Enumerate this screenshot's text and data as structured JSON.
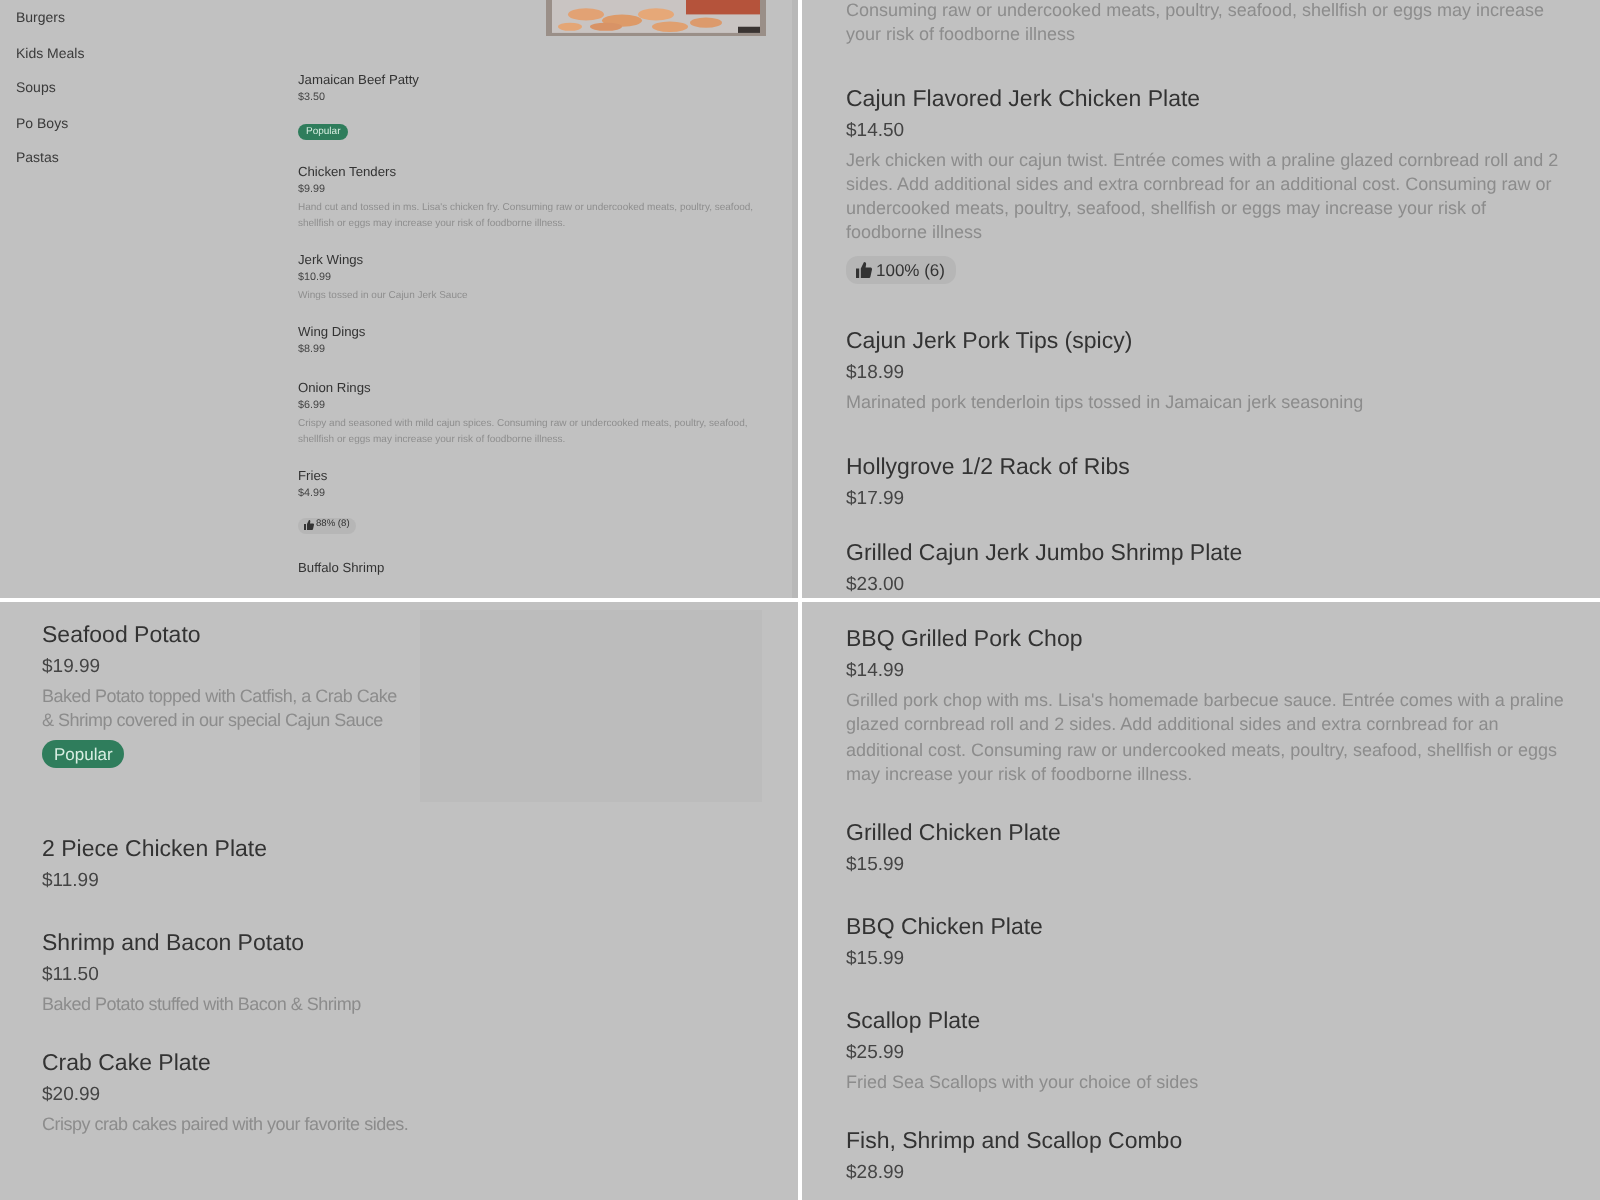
{
  "panels": [
    {
      "kind": "compact",
      "sidebar": {
        "items": [
          {
            "label": "Burgers"
          },
          {
            "label": "Kids Meals"
          },
          {
            "label": "Soups"
          },
          {
            "label": "Po Boys"
          },
          {
            "label": "Pastas"
          }
        ]
      },
      "items": [
        {
          "name": "Jamaican Beef Patty",
          "price": "$3.50",
          "badge": "Popular"
        },
        {
          "name": "Chicken Tenders",
          "price": "$9.99",
          "description": "Hand cut and tossed in ms. Lisa's chicken fry. Consuming raw or undercooked meats, poultry, seafood, shellfish or eggs may increase your risk of foodborne illness."
        },
        {
          "name": "Jerk Wings",
          "price": "$10.99",
          "description": "Wings tossed in our Cajun Jerk Sauce"
        },
        {
          "name": "Wing Dings",
          "price": "$8.99"
        },
        {
          "name": "Onion Rings",
          "price": "$6.99",
          "description": "Crispy and seasoned with mild cajun spices. Consuming raw or undercooked meats, poultry, seafood, shellfish or eggs may increase your risk of foodborne illness."
        },
        {
          "name": "Fries",
          "price": "$4.99",
          "rating": "88% (8)"
        },
        {
          "name": "Buffalo Shrimp"
        }
      ]
    },
    {
      "kind": "regular",
      "items": [
        {
          "description": "Consuming raw or undercooked meats, poultry, seafood, shellfish or eggs may increase your risk of foodborne illness"
        },
        {
          "name": "Cajun Flavored Jerk Chicken Plate",
          "price": "$14.50",
          "description": "Jerk chicken with our cajun twist. Entrée comes with a praline glazed cornbread roll and 2 sides. Add additional sides and extra cornbread for an additional cost. Consuming raw or undercooked meats, poultry, seafood, shellfish or eggs may increase your risk of foodborne illness",
          "rating": "100% (6)"
        },
        {
          "name": "Cajun Jerk Pork Tips (spicy)",
          "price": "$18.99",
          "description": "Marinated pork tenderloin tips tossed in Jamaican jerk seasoning"
        },
        {
          "name": "Hollygrove 1/2 Rack of Ribs",
          "price": "$17.99"
        },
        {
          "name": "Grilled Cajun Jerk Jumbo Shrimp Plate",
          "price": "$23.00"
        }
      ]
    },
    {
      "kind": "regular",
      "image": {
        "kind": "placeholder"
      },
      "items": [
        {
          "name": "Seafood Potato",
          "price": "$19.99",
          "description": "Baked Potato topped with Catfish, a Crab Cake & Shrimp covered in our special Cajun Sauce",
          "badge": "Popular"
        },
        {
          "name": "2 Piece Chicken Plate",
          "price": "$11.99"
        },
        {
          "name": "Shrimp and Bacon Potato",
          "price": "$11.50",
          "description": "Baked Potato stuffed with Bacon & Shrimp"
        },
        {
          "name": "Crab Cake Plate",
          "price": "$20.99",
          "description": "Crispy crab cakes paired with your favorite sides."
        }
      ]
    },
    {
      "kind": "regular",
      "items": [
        {
          "name": "BBQ Grilled Pork Chop",
          "price": "$14.99",
          "description": "Grilled pork chop with ms. Lisa's homemade barbecue sauce. Entrée comes with a praline glazed cornbread roll and 2 sides. Add additional sides and extra cornbread for an additional cost. Consuming raw or undercooked meats, poultry, seafood, shellfish or eggs may increase your risk of foodborne illness."
        },
        {
          "name": "Grilled Chicken Plate",
          "price": "$15.99"
        },
        {
          "name": "BBQ Chicken Plate",
          "price": "$15.99"
        },
        {
          "name": "Scallop Plate",
          "price": "$25.99",
          "description": "Fried Sea Scallops with your choice of sides"
        },
        {
          "name": "Fish, Shrimp and Scallop Combo",
          "price": "$28.99"
        }
      ]
    }
  ]
}
